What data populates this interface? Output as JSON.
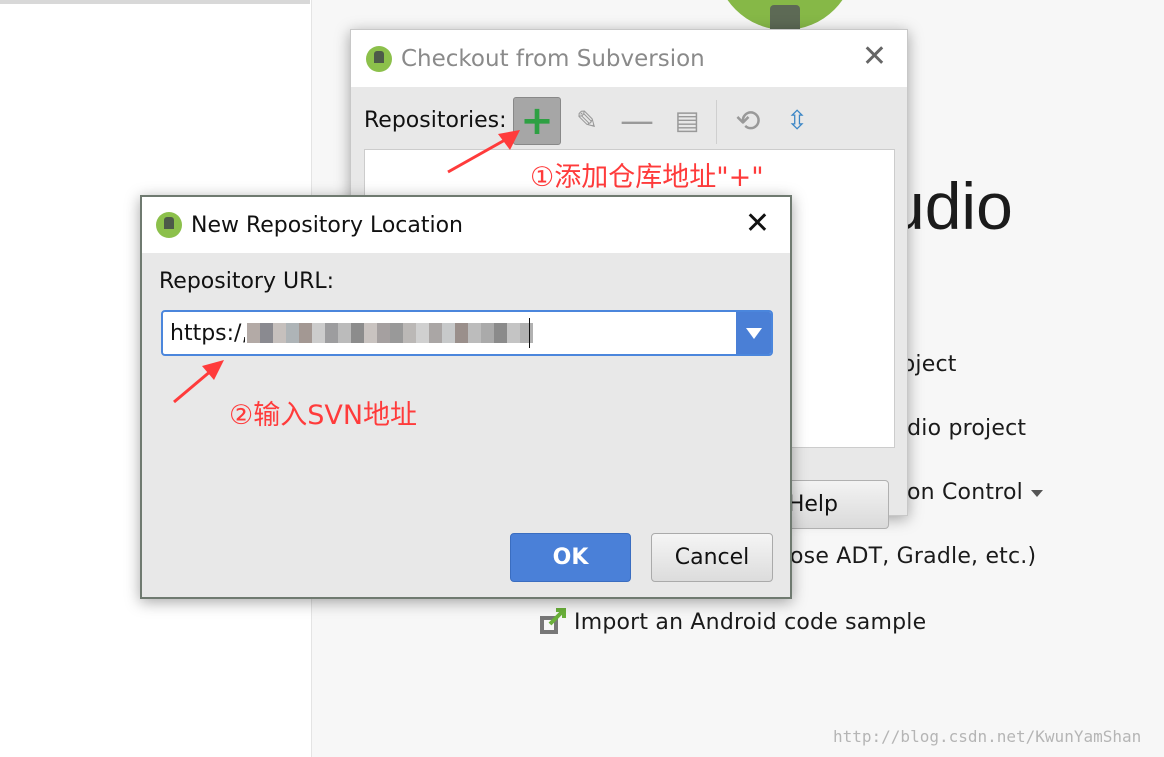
{
  "welcome": {
    "title_fragment": "udio",
    "items": [
      "roject",
      "udio project",
      "on Control",
      "ose ADT, Gradle, etc.)",
      "Import an Android code sample"
    ]
  },
  "checkout_dialog": {
    "title": "Checkout from Subversion",
    "repositories_label": "Repositories:",
    "toolbar_icons": [
      "add-icon",
      "edit-icon",
      "remove-icon",
      "info-icon",
      "refresh-icon",
      "collapse-icon"
    ],
    "help_label": "Help"
  },
  "new_repo_dialog": {
    "title": "New Repository Location",
    "url_label": "Repository URL:",
    "url_value": "https:/,",
    "ok_label": "OK",
    "cancel_label": "Cancel"
  },
  "annotations": {
    "step1": "①添加仓库地址\"+\"",
    "step2": "②输入SVN地址",
    "color": "#ff3b3b"
  },
  "watermark": "http://blog.csdn.net/KwunYamShan",
  "colors": {
    "accent": "#4a80d8",
    "android_green": "#8cc04b"
  }
}
